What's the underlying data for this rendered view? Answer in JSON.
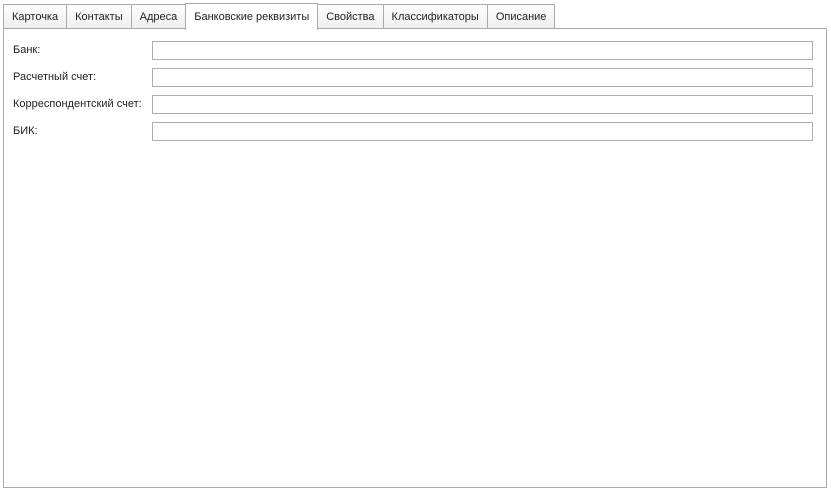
{
  "tabs": [
    {
      "label": "Карточка",
      "active": false
    },
    {
      "label": "Контакты",
      "active": false
    },
    {
      "label": "Адреса",
      "active": false
    },
    {
      "label": "Банковские реквизиты",
      "active": true
    },
    {
      "label": "Свойства",
      "active": false
    },
    {
      "label": "Классификаторы",
      "active": false
    },
    {
      "label": "Описание",
      "active": false
    }
  ],
  "form": {
    "bank": {
      "label": "Банк:",
      "value": ""
    },
    "account": {
      "label": "Расчетный счет:",
      "value": ""
    },
    "corr_account": {
      "label": "Корреспондентский счет:",
      "value": ""
    },
    "bik": {
      "label": "БИК:",
      "value": ""
    }
  }
}
